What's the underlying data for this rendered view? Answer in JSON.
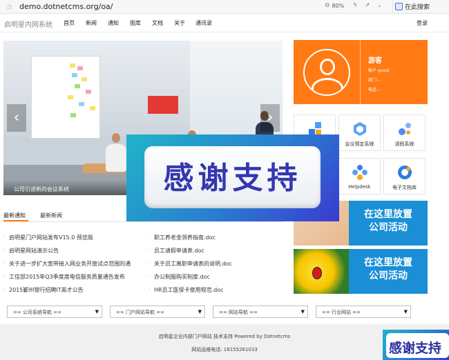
{
  "browser": {
    "url": "demo.dotnetcms.org/oa/",
    "zoom": "80%",
    "search_placeholder": "在此搜索"
  },
  "nav": {
    "brand": "启明星内网系统",
    "items": [
      "首页",
      "新闻",
      "通知",
      "图库",
      "文档",
      "关于",
      "通讯录"
    ],
    "login": "登录"
  },
  "carousel": {
    "caption": "公司引进新的会议系统",
    "prev_icon": "chevron-left-icon",
    "next_icon": "chevron-right-icon"
  },
  "profile": {
    "name": "游客",
    "account": "帐户 guest",
    "department": "部门 --",
    "phone": "电话 --"
  },
  "tiles": [
    {
      "label": "",
      "icon": "blocks-icon",
      "color": "#2f7de1"
    },
    {
      "label": "会议预定系统",
      "icon": "meeting-icon",
      "color": "#3a7ee8"
    },
    {
      "label": "请假系统",
      "icon": "leave-icon",
      "color": "#4a8ff0"
    },
    {
      "label": "",
      "icon": "app-icon",
      "color": "#3a7ee8"
    },
    {
      "label": "Helpdesk",
      "icon": "helpdesk-icon",
      "color": "#3a7ee8"
    },
    {
      "label": "电子文档库",
      "icon": "doc-library-icon",
      "color": "#2f7de1"
    }
  ],
  "tabs": {
    "latest_notice": "最新通知",
    "latest_news": "最新新闻"
  },
  "news_left": [
    "启明星门户网站发布V15.0 预览版",
    "启明星网站演示公告",
    "关于进一步扩大宽带接入网业务开放试点范围的通",
    "工信部2015年Q3季度度电信服务质量通告发布",
    "2015鄞州银行招聘IT英才公告"
  ],
  "news_right": [
    "职工养老金领养指南.doc",
    "员工请假申请表.doc",
    "关于员工离职申请表的说明.doc",
    "办公制服购买制度.doc",
    "HR员工医保卡使用规范.doc"
  ],
  "banners": {
    "line1": "在这里放置",
    "line2": "公司活动"
  },
  "dropdowns": [
    "== 公司系统导航 ==",
    "== 门户网站导航 ==",
    "== 网站导航 ==",
    "== 行业网站 =="
  ],
  "footer": {
    "line1": "启明星企业内部门户网站 技术支持 Powered by Dotnetcms",
    "line2": "网站运维电话:    18155261033"
  },
  "overlay": {
    "text": "感谢支持"
  },
  "colors": {
    "accent": "#ff7a14",
    "banner_blue": "#1a8fd6"
  }
}
